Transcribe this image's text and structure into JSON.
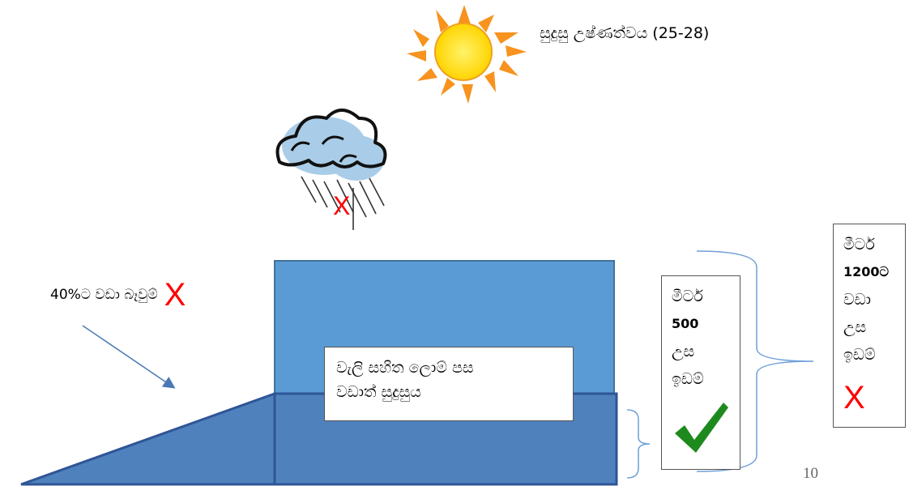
{
  "sun_label": "සුදුසු උෂ්ණත්වය (25-28)",
  "cloud_mark": "X",
  "slope_label": "40%ට වඩා බෑවුම්",
  "slope_mark": "X",
  "soil_label": {
    "line1": "වැලි සහිත ලොම් පස",
    "line2": "වඩාත් සුදුසුය"
  },
  "altitude_500": {
    "line1": "මීටර්",
    "line2": "500",
    "line3": "උස",
    "line4": "ඉඩම්",
    "status": "check"
  },
  "altitude_1200": {
    "line1": "මීටර්",
    "line2": "1200ට",
    "line3": "වඩා",
    "line4": "උස",
    "line5": "ඉඩම්",
    "mark": "X"
  },
  "slide_number": "10",
  "colors": {
    "upper_block": "#5b9bd5",
    "lower_block": "#4f81bd",
    "outline": "#3a5f8f",
    "bracket": "#6f9fd8",
    "check": "#1e8a1e",
    "cross": "#ff0000",
    "sun_core": "#ffe92e",
    "sun_rays": "#f7931e",
    "cloud": "#a9cde8"
  }
}
